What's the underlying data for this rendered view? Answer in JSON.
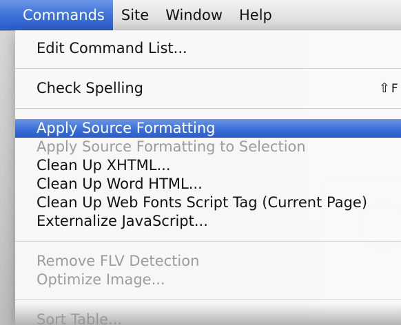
{
  "menubar": {
    "items": [
      {
        "label": "Commands",
        "active": true
      },
      {
        "label": "Site",
        "active": false
      },
      {
        "label": "Window",
        "active": false
      },
      {
        "label": "Help",
        "active": false
      }
    ]
  },
  "menu": {
    "edit_command_list": "Edit Command List...",
    "check_spelling": "Check Spelling",
    "check_spelling_shortcut_symbol": "⇧",
    "check_spelling_shortcut_key": "F",
    "apply_source_formatting": "Apply Source Formatting",
    "apply_source_formatting_selection": "Apply Source Formatting to Selection",
    "clean_up_xhtml": "Clean Up XHTML...",
    "clean_up_word_html": "Clean Up Word HTML...",
    "clean_up_web_fonts": "Clean Up Web Fonts Script Tag (Current Page)",
    "externalize_javascript": "Externalize JavaScript...",
    "remove_flv_detection": "Remove FLV Detection",
    "optimize_image": "Optimize Image...",
    "sort_table": "Sort Table..."
  },
  "colors": {
    "highlight": "#3b6fd6",
    "disabled_text": "#9c9c9c"
  }
}
